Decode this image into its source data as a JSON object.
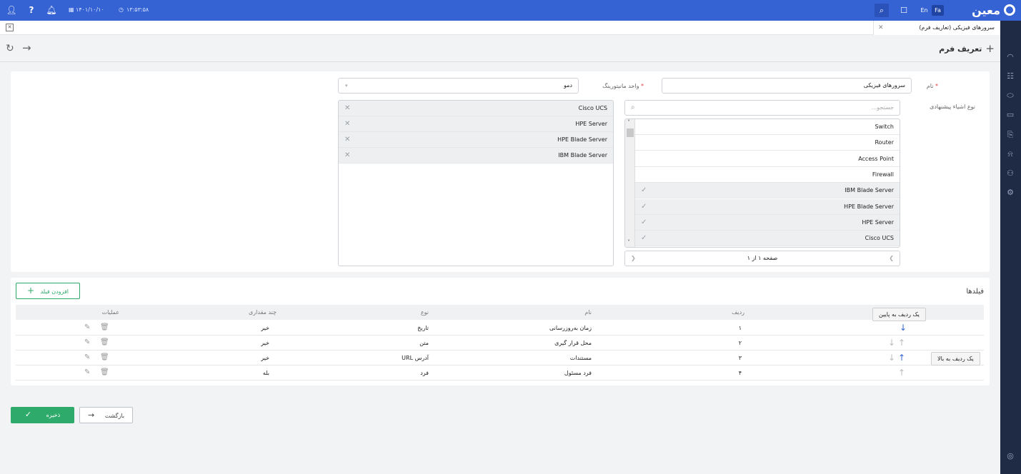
{
  "topbar": {
    "time": "۱۳:۵۳:۵۸",
    "date": "۱۴۰۱/۱۰/۱۰",
    "logo_text": "معین",
    "lang_en": "En",
    "lang_fa": "Fa"
  },
  "tab": {
    "title": "سرورهای فیزیکی (تعاریف فرم)"
  },
  "page": {
    "title": "تعریف فرم"
  },
  "form": {
    "name_label": "نام",
    "name_value": "سرورهای فیزیکی",
    "unit_label": "واحد مانیتورینگ",
    "unit_value": "دمو",
    "types_label": "نوع اشیاء پیشنهادی",
    "search_placeholder": "جستجو...",
    "available_items": [
      {
        "label": "Switch",
        "selected": false
      },
      {
        "label": "Router",
        "selected": false
      },
      {
        "label": "Access Point",
        "selected": false
      },
      {
        "label": "Firewall",
        "selected": false
      },
      {
        "label": "IBM Blade Server",
        "selected": true
      },
      {
        "label": "HPE Blade Server",
        "selected": true
      },
      {
        "label": "HPE Server",
        "selected": true
      },
      {
        "label": "Cisco UCS",
        "selected": true
      }
    ],
    "pagination": "صفحه ۱ از ۱",
    "selected_items": [
      "Cisco UCS",
      "HPE Server",
      "HPE Blade Server",
      "IBM Blade Server"
    ]
  },
  "fields": {
    "title": "فیلدها",
    "add_button": "افزودن فیلد",
    "columns": {
      "row": "ردیف",
      "name": "نام",
      "type": "نوع",
      "multi": "چند مقداری",
      "ops": "عملیات"
    },
    "rows": [
      {
        "num": "۱",
        "name": "زمان به‌روزرسانی",
        "type": "تاریخ",
        "multi": "خیر"
      },
      {
        "num": "۲",
        "name": "محل قرار گیری",
        "type": "متن",
        "multi": "خیر"
      },
      {
        "num": "۳",
        "name": "مستندات",
        "type": "آدرس URL",
        "multi": "خیر"
      },
      {
        "num": "۴",
        "name": "فرد مسئول",
        "type": "فرد",
        "multi": "بله"
      }
    ],
    "tooltip_down": "یک ردیف به پایین",
    "tooltip_up": "یک ردیف به بالا"
  },
  "actions": {
    "save": "ذخیره",
    "back": "بازگشت"
  },
  "colors": {
    "primary": "#3563d4",
    "sidebar": "#1f2b45",
    "success": "#2eaa6a"
  }
}
